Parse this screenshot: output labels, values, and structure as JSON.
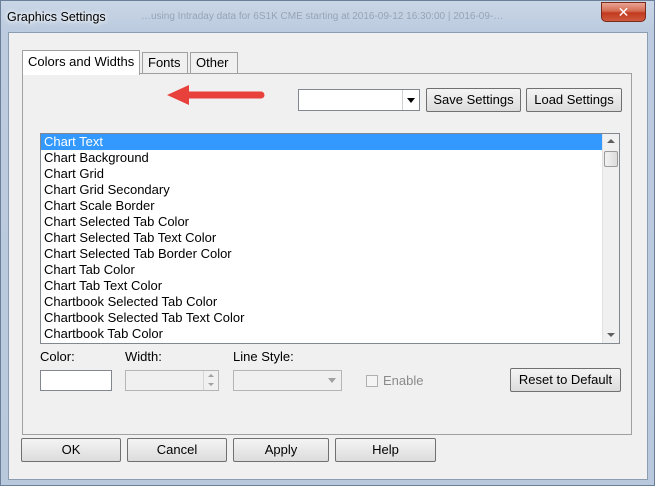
{
  "window": {
    "title": "Graphics Settings",
    "background_title_text": "…using Intraday data for 6S1K CME starting at 2016-09-12 16:30:00 | 2016-09-…",
    "close_glyph": "✕"
  },
  "tabs": [
    {
      "label": "Colors and Widths",
      "active": true
    },
    {
      "label": "Fonts",
      "active": false
    },
    {
      "label": "Other",
      "active": false
    }
  ],
  "settings_combo": {
    "value": ""
  },
  "buttons": {
    "save_settings": "Save Settings",
    "load_settings": "Load Settings",
    "reset_to_default": "Reset to Default",
    "ok": "OK",
    "cancel": "Cancel",
    "apply": "Apply",
    "help": "Help"
  },
  "list": {
    "items": [
      "Chart Text",
      "Chart Background",
      "Chart Grid",
      "Chart Grid Secondary",
      "Chart Scale Border",
      "Chart Selected Tab Color",
      "Chart Selected Tab Text Color",
      "Chart Selected Tab Border Color",
      "Chart Tab Color",
      "Chart Tab Text Color",
      "Chartbook Selected Tab Color",
      "Chartbook Selected Tab Text Color",
      "Chartbook Tab Color"
    ],
    "selected_index": 0
  },
  "fields": {
    "color_label": "Color:",
    "width_label": "Width:",
    "line_style_label": "Line Style:",
    "enable_label": "Enable",
    "width_value": "",
    "line_style_value": ""
  },
  "colors": {
    "selection": "#3399ff",
    "arrow": "#e8413c"
  },
  "icons": {
    "arrow": "red-arrow-annotation",
    "dropdown": "chevron-down-icon"
  }
}
